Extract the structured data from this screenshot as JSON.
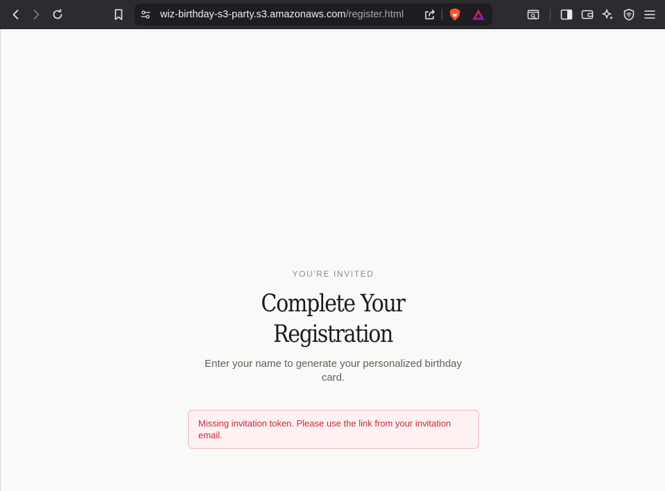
{
  "browser": {
    "url_host": "wiz-birthday-s3-party.s3.amazonaws.com",
    "url_path": "/register.html",
    "icons": {
      "back": "back-arrow-icon",
      "forward": "forward-arrow-icon",
      "reload": "reload-icon",
      "bookmark": "bookmark-icon",
      "site_info": "site-settings-icon",
      "share": "share-icon",
      "brave_shields": "brave-lion-icon",
      "rewards": "brave-rewards-triangle-icon",
      "leo": "leo-search-icon",
      "sidebar": "sidebar-icon",
      "wallet": "wallet-icon",
      "ai": "sparkle-ai-icon",
      "vpn": "vpn-shield-icon",
      "menu": "hamburger-menu-icon"
    },
    "colors": {
      "toolbar_bg": "#2c2c30",
      "brave_orange": "#fb542b"
    }
  },
  "page": {
    "eyebrow": "YOU'RE INVITED",
    "title_line1": "Complete Your",
    "title_line2": "Registration",
    "subtitle": "Enter your name to generate your personalized birthday card.",
    "error_message": "Missing invitation token. Please use the link from your invitation email.",
    "colors": {
      "background": "#f9f9f7",
      "error_text": "#c8283a",
      "error_bg": "#fdf1f1",
      "error_border": "#f0b8b8"
    }
  }
}
